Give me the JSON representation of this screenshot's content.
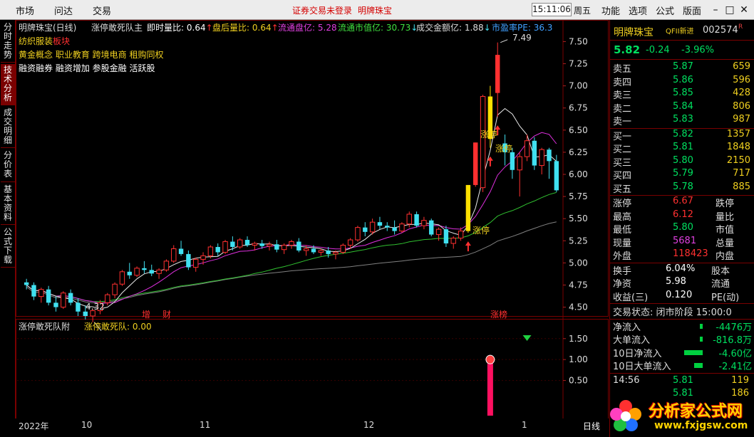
{
  "menu": {
    "market": "市场",
    "ask": "问达",
    "trade": "交易",
    "alert": "证券交易未登录",
    "stock_name": "明牌珠宝",
    "time": "15:11:06",
    "weekday": "周五",
    "func": "功能",
    "options": "选项",
    "formula": "公式",
    "layout": "版面"
  },
  "left_tabs": [
    "分时走势",
    "技术分析",
    "成交明细",
    "分价表",
    "基本资料",
    "公式下载"
  ],
  "header": {
    "name": "明牌珠宝(日线)",
    "indicator": "涨停敢死队主",
    "k1": "即时量比:",
    "v1": "0.64",
    "k2": "盘后量比:",
    "v2": "0.64",
    "k3": "流通盘亿:",
    "v3": "5.28",
    "k4": "流通市值亿:",
    "v4": "30.73",
    "k5": "成交金额亿:",
    "v5": "1.88",
    "k6": "市盈率PE:",
    "v6": "36.3"
  },
  "concepts": {
    "line1_a": "纺织服装",
    "line1_b": "板块",
    "line2": "黄金概念 职业教育 跨境电商 租购同权",
    "line3": "融资融券 融资增加 参股金融 活跃股"
  },
  "chart_labels": {
    "high": "7.49",
    "low": "4.32",
    "zt1": "涨停",
    "zt2": "涨停",
    "zt3": "涨停",
    "mark_inc": "增",
    "mark_fin": "财",
    "mark_list": "涨榜"
  },
  "sub_header": {
    "name": "涨停敢死队附",
    "k": "涨停敢死队:",
    "v": "0.00"
  },
  "x_axis": {
    "y2022": "2022年",
    "m10": "10",
    "m11": "11",
    "m12": "12",
    "m1": "1",
    "period": "日线"
  },
  "chart_data": {
    "type": "candlestick",
    "main_y_ticks": [
      "7.50",
      "7.25",
      "7.00",
      "6.75",
      "6.50",
      "6.25",
      "6.00",
      "5.75",
      "5.50",
      "5.25",
      "5.00",
      "4.75",
      "4.50"
    ],
    "sub_y_ticks": [
      "1.50",
      "1.00",
      "0.50"
    ],
    "ylim": [
      4.4,
      7.6
    ],
    "candles": [
      [
        4.78,
        4.82,
        4.7,
        4.75
      ],
      [
        4.75,
        4.78,
        4.58,
        4.62
      ],
      [
        4.62,
        4.72,
        4.55,
        4.7
      ],
      [
        4.7,
        4.74,
        4.52,
        4.55
      ],
      [
        4.55,
        4.62,
        4.45,
        4.5
      ],
      [
        4.5,
        4.68,
        4.48,
        4.66
      ],
      [
        4.66,
        4.7,
        4.52,
        4.55
      ],
      [
        4.55,
        4.6,
        4.4,
        4.45
      ],
      [
        4.45,
        4.52,
        4.36,
        4.4
      ],
      [
        4.4,
        4.48,
        4.33,
        4.46
      ],
      [
        4.46,
        4.58,
        4.42,
        4.55
      ],
      [
        4.55,
        4.66,
        4.52,
        4.64
      ],
      [
        4.64,
        4.78,
        4.6,
        4.76
      ],
      [
        4.76,
        4.92,
        4.74,
        4.9
      ],
      [
        4.9,
        5.0,
        4.82,
        4.86
      ],
      [
        4.86,
        4.96,
        4.84,
        4.94
      ],
      [
        4.94,
        5.02,
        4.88,
        4.92
      ],
      [
        4.92,
        4.98,
        4.85,
        4.88
      ],
      [
        4.88,
        4.94,
        4.82,
        4.92
      ],
      [
        4.92,
        5.04,
        4.9,
        5.02
      ],
      [
        5.02,
        5.2,
        5.0,
        5.16
      ],
      [
        5.16,
        5.25,
        5.08,
        5.1
      ],
      [
        5.1,
        5.14,
        4.92,
        4.95
      ],
      [
        4.95,
        5.06,
        4.9,
        5.04
      ],
      [
        5.04,
        5.12,
        4.98,
        5.08
      ],
      [
        5.08,
        5.2,
        5.05,
        5.18
      ],
      [
        5.18,
        5.22,
        5.08,
        5.12
      ],
      [
        5.12,
        5.26,
        5.1,
        5.24
      ],
      [
        5.24,
        5.3,
        5.14,
        5.18
      ],
      [
        5.18,
        5.28,
        5.16,
        5.26
      ],
      [
        5.26,
        5.3,
        5.18,
        5.2
      ],
      [
        5.2,
        5.24,
        5.14,
        5.22
      ],
      [
        5.22,
        5.26,
        5.16,
        5.19
      ],
      [
        5.19,
        5.24,
        5.14,
        5.21
      ],
      [
        5.21,
        5.26,
        5.12,
        5.15
      ],
      [
        5.15,
        5.22,
        5.1,
        5.2
      ],
      [
        5.2,
        5.26,
        5.16,
        5.24
      ],
      [
        5.24,
        5.28,
        5.12,
        5.14
      ],
      [
        5.14,
        5.2,
        5.08,
        5.16
      ],
      [
        5.16,
        5.2,
        5.1,
        5.12
      ],
      [
        5.12,
        5.16,
        5.08,
        5.14
      ],
      [
        5.14,
        5.18,
        5.06,
        5.1
      ],
      [
        5.1,
        5.14,
        5.04,
        5.12
      ],
      [
        5.12,
        5.22,
        5.1,
        5.2
      ],
      [
        5.2,
        5.28,
        5.16,
        5.26
      ],
      [
        5.26,
        5.42,
        5.24,
        5.4
      ],
      [
        5.4,
        5.46,
        5.3,
        5.35
      ],
      [
        5.35,
        5.5,
        5.32,
        5.46
      ],
      [
        5.46,
        5.52,
        5.38,
        5.42
      ],
      [
        5.42,
        5.46,
        5.36,
        5.4
      ],
      [
        5.4,
        5.48,
        5.32,
        5.36
      ],
      [
        5.36,
        5.46,
        5.34,
        5.44
      ],
      [
        5.44,
        5.58,
        5.4,
        5.55
      ],
      [
        5.55,
        5.58,
        5.4,
        5.42
      ],
      [
        5.42,
        5.52,
        5.38,
        5.48
      ],
      [
        5.48,
        5.5,
        5.3,
        5.32
      ],
      [
        5.32,
        5.4,
        5.25,
        5.38
      ],
      [
        5.38,
        5.42,
        5.18,
        5.22
      ],
      [
        5.22,
        5.3,
        5.16,
        5.28
      ],
      [
        5.28,
        5.4,
        5.25,
        5.36
      ],
      [
        5.36,
        5.88,
        5.34,
        5.88
      ],
      [
        5.88,
        6.36,
        5.86,
        6.36
      ],
      [
        5.85,
        6.9,
        5.8,
        6.88
      ],
      [
        6.4,
        7.0,
        6.3,
        6.88
      ],
      [
        6.92,
        7.49,
        6.65,
        7.35
      ],
      [
        6.35,
        6.45,
        6.1,
        6.25
      ],
      [
        6.25,
        6.3,
        5.95,
        6.05
      ],
      [
        6.05,
        6.25,
        5.75,
        6.2
      ],
      [
        6.2,
        6.45,
        6.15,
        6.38
      ],
      [
        6.38,
        6.42,
        6.05,
        6.1
      ],
      [
        6.1,
        6.3,
        6.0,
        6.28
      ],
      [
        6.28,
        6.3,
        5.95,
        6.15
      ],
      [
        6.15,
        6.22,
        5.8,
        5.82
      ]
    ],
    "limit_up_candle_indexes": [
      60,
      61,
      63,
      64
    ],
    "sub_bar": {
      "candle_index": 63,
      "value": 1.0
    }
  },
  "quote": {
    "name": "明牌珠宝",
    "tag": "QFII新进",
    "code": "002574",
    "flag": "R",
    "price": "5.82",
    "change": "-0.24",
    "pct": "-3.96%",
    "asks": [
      [
        "卖五",
        "5.87",
        "659"
      ],
      [
        "卖四",
        "5.86",
        "596"
      ],
      [
        "卖三",
        "5.85",
        "428"
      ],
      [
        "卖二",
        "5.84",
        "806"
      ],
      [
        "卖一",
        "5.83",
        "987"
      ]
    ],
    "bids": [
      [
        "买一",
        "5.82",
        "1357"
      ],
      [
        "买二",
        "5.81",
        "1848"
      ],
      [
        "买三",
        "5.80",
        "2150"
      ],
      [
        "买四",
        "5.79",
        "717"
      ],
      [
        "买五",
        "5.78",
        "885"
      ]
    ],
    "stats": [
      [
        "涨停",
        "6.67",
        "跌停"
      ],
      [
        "最高",
        "6.12",
        "量比"
      ],
      [
        "最低",
        "5.80",
        "市值"
      ],
      [
        "现量",
        "5681",
        "总量"
      ],
      [
        "外盘",
        "118423",
        "内盘"
      ]
    ],
    "stats2": [
      [
        "换手",
        "6.04%",
        "股本"
      ],
      [
        "净资",
        "5.98",
        "流通"
      ],
      [
        "收益(三)",
        "0.120",
        "PE(动)"
      ]
    ],
    "status": "交易状态: 闭市阶段 15:00:0",
    "flows": [
      [
        "净流入",
        "-4476万"
      ],
      [
        "大单流入",
        "-816.8万"
      ],
      [
        "10日净流入",
        "-4.60亿"
      ],
      [
        "10日大单流入",
        "-2.41亿"
      ]
    ],
    "ticks": [
      [
        "14:56",
        "5.81",
        "119"
      ],
      [
        "",
        "5.81",
        "186"
      ]
    ]
  },
  "logo": {
    "title": "分析家公式网",
    "url": "www.fxjgsw.com"
  },
  "colors": {
    "up": "#ff3030",
    "down": "#40e0f0",
    "limit": "#ffe000",
    "border": "#7a0000",
    "yellow": "#f0d020",
    "green": "#00e060"
  }
}
